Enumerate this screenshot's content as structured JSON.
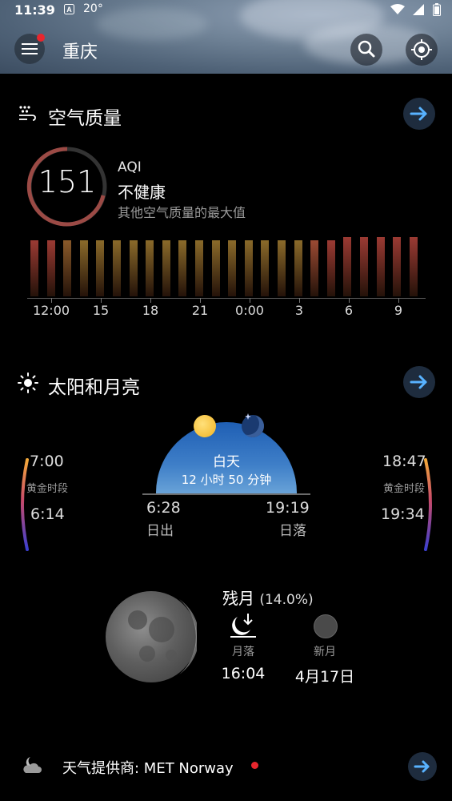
{
  "status": {
    "time": "11:39",
    "temp": "20°"
  },
  "header": {
    "city": "重庆"
  },
  "air_quality": {
    "title": "空气质量",
    "aqi_value": "151",
    "aqi_label": "AQI",
    "status": "不健康",
    "note": "其他空气质量的最大值",
    "hour_labels": [
      "12:00",
      "15",
      "18",
      "21",
      "0:00",
      "3",
      "6",
      "9"
    ]
  },
  "sun_moon": {
    "title": "太阳和月亮",
    "golden_morning_start": "7:00",
    "golden_label": "黄金时段",
    "golden_morning_end": "6:14",
    "golden_evening_start": "18:47",
    "golden_evening_end": "19:34",
    "day_label": "白天",
    "day_length": "12 小时 50 分钟",
    "sunrise_time": "6:28",
    "sunrise_label": "日出",
    "sunset_time": "19:19",
    "sunset_label": "日落",
    "moon_phase": "残月",
    "moon_illumination": "(14.0%)",
    "moonset_label": "月落",
    "moonset_time": "16:04",
    "new_moon_label": "新月",
    "new_moon_date": "4月17日"
  },
  "footer": {
    "provider": "天气提供商: MET Norway"
  }
}
